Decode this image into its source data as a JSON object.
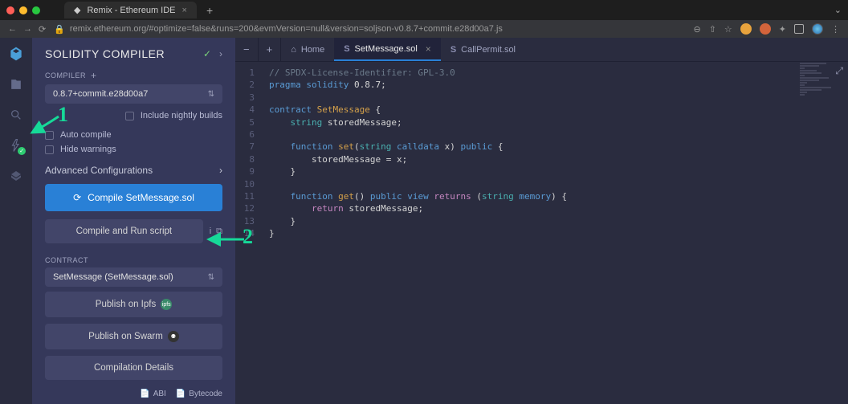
{
  "browser": {
    "tab_title": "Remix - Ethereum IDE",
    "url": "remix.ethereum.org/#optimize=false&runs=200&evmVersion=null&version=soljson-v0.8.7+commit.e28d00a7.js"
  },
  "activity": {
    "items": [
      "logo-icon",
      "file-explorer-icon",
      "search-icon",
      "compiler-icon",
      "deploy-icon"
    ]
  },
  "panel": {
    "title": "SOLIDITY COMPILER",
    "compiler_label": "COMPILER",
    "version": "0.8.7+commit.e28d00a7",
    "include_nightly": "Include nightly builds",
    "auto_compile": "Auto compile",
    "hide_warnings": "Hide warnings",
    "advanced": "Advanced Configurations",
    "compile_btn": "Compile SetMessage.sol",
    "run_script_btn": "Compile and Run script",
    "contract_label": "CONTRACT",
    "contract_value": "SetMessage (SetMessage.sol)",
    "publish_ipfs": "Publish on Ipfs",
    "publish_swarm": "Publish on Swarm",
    "details_btn": "Compilation Details",
    "abi_link": "ABI",
    "bytecode_link": "Bytecode"
  },
  "tabs": {
    "home": "Home",
    "file1": "SetMessage.sol",
    "file2": "CallPermit.sol"
  },
  "code": {
    "lines": [
      "// SPDX-License-Identifier: GPL-3.0",
      "pragma solidity 0.8.7;",
      "",
      "contract SetMessage {",
      "    string storedMessage;",
      "",
      "    function set(string calldata x) public {",
      "        storedMessage = x;",
      "    }",
      "",
      "    function get() public view returns (string memory) {",
      "        return storedMessage;",
      "    }",
      "}"
    ]
  },
  "annotations": {
    "a1": "1",
    "a2": "2"
  }
}
